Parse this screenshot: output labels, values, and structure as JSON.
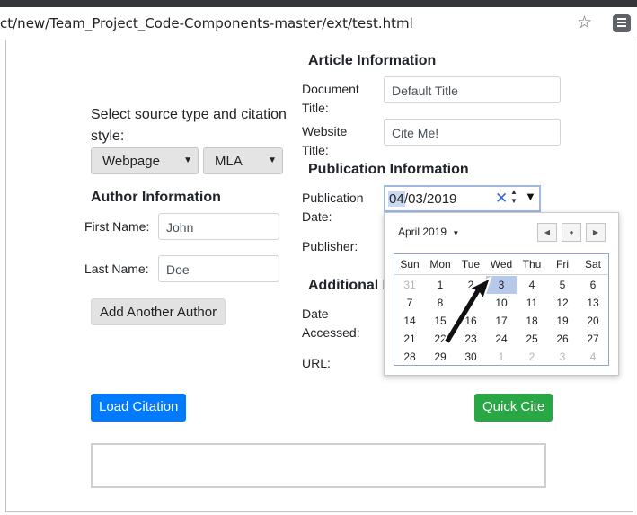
{
  "browser": {
    "url": "ct/new/Team_Project_Code-Components-master/ext/test.html"
  },
  "source": {
    "prompt": "Select source type and citation style:",
    "type_selected": "Webpage",
    "style_selected": "MLA"
  },
  "author": {
    "heading": "Author Information",
    "first_label": "First Name:",
    "first_value": "John",
    "last_label": "Last Name:",
    "last_value": "Doe",
    "add_button": "Add Another Author"
  },
  "article": {
    "heading": "Article Information",
    "doc_label": "Document Title:",
    "doc_value": "Default Title",
    "site_label": "Website Title:",
    "site_value": "Cite Me!"
  },
  "publication": {
    "heading": "Publication Information",
    "date_label": "Publication Date:",
    "date_month": "04",
    "date_rest": "/03/2019",
    "publisher_label": "Publisher:"
  },
  "additional": {
    "heading": "Additional In",
    "accessed_label": "Date Accessed:",
    "url_label": "URL:"
  },
  "buttons": {
    "load": "Load Citation",
    "quick": "Quick Cite"
  },
  "calendar": {
    "month_label": "April 2019",
    "weekdays": [
      "Sun",
      "Mon",
      "Tue",
      "Wed",
      "Thu",
      "Fri",
      "Sat"
    ],
    "weeks": [
      [
        "31",
        "1",
        "2",
        "3",
        "4",
        "5",
        "6"
      ],
      [
        "7",
        "8",
        "9",
        "10",
        "11",
        "12",
        "13"
      ],
      [
        "14",
        "15",
        "16",
        "17",
        "18",
        "19",
        "20"
      ],
      [
        "21",
        "22",
        "23",
        "24",
        "25",
        "26",
        "27"
      ],
      [
        "28",
        "29",
        "30",
        "1",
        "2",
        "3",
        "4"
      ]
    ],
    "selected": "3"
  },
  "icons": {
    "star": "star-icon",
    "extension": "extension-icon",
    "clear": "clear-icon",
    "spinner": "spinner-icon",
    "dropdown": "dropdown-arrow-icon",
    "cursor": "cursor-arrow-icon"
  }
}
